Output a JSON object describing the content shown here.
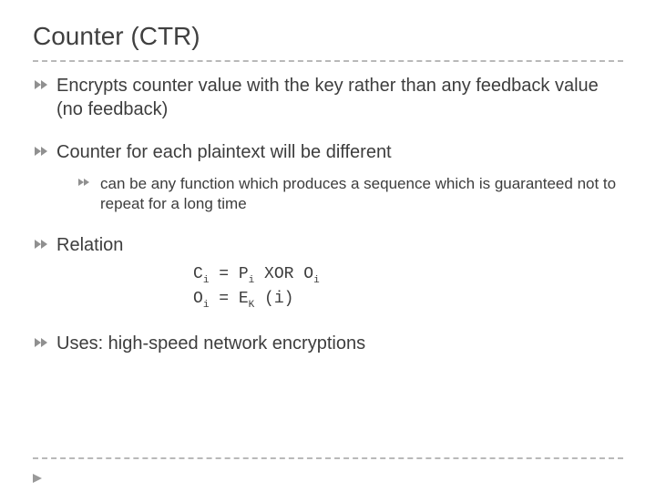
{
  "title": "Counter (CTR)",
  "bullets": {
    "b1": "Encrypts counter value with the key rather than any feedback value (no feedback)",
    "b2": "Counter for each plaintext will be different",
    "b2_sub1": "can be any function which produces a sequence which is guaranteed not to repeat for a long time",
    "b3": "Relation",
    "b4": "Uses: high-speed network encryptions"
  },
  "code": {
    "c": "C",
    "i": "i",
    "eq": " = ",
    "p": "P",
    "xor": " XOR ",
    "o": "O",
    "e": "E",
    "k": "K",
    "paren_i": " (i)"
  }
}
